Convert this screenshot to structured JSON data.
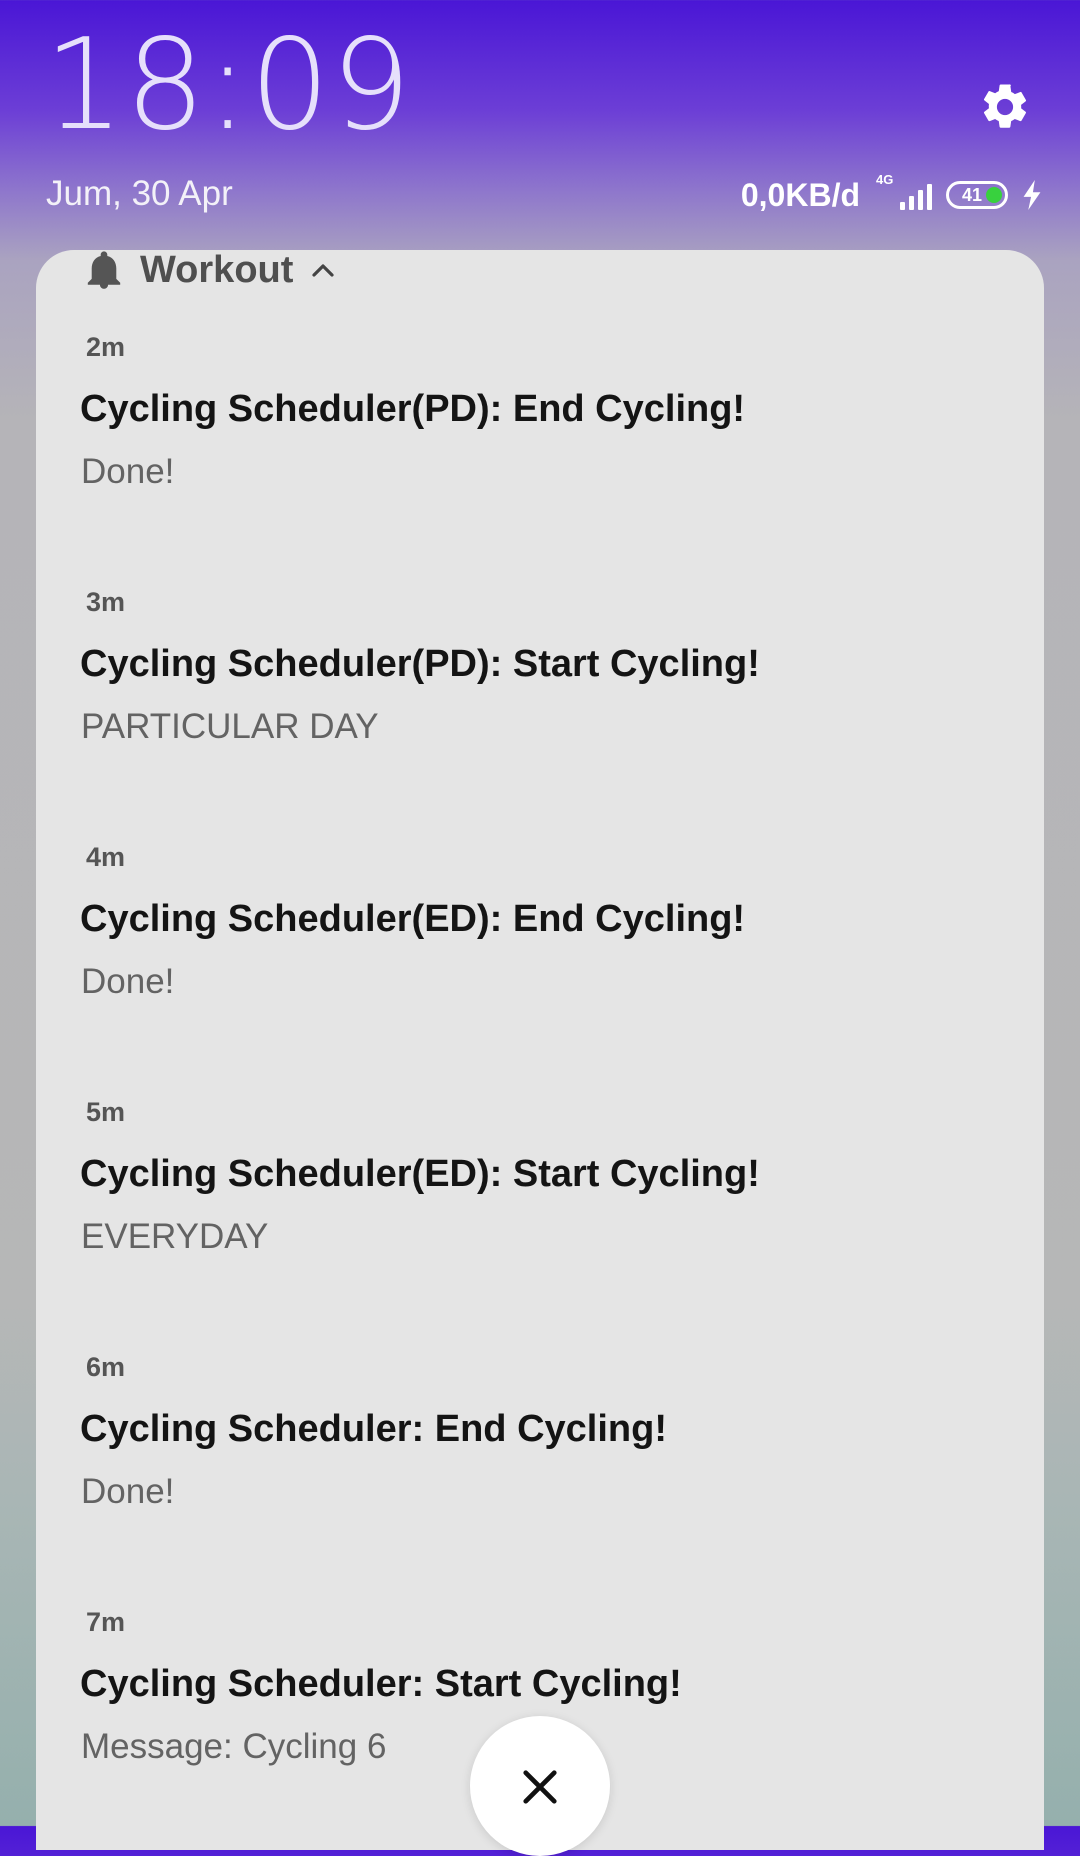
{
  "status": {
    "clock": "18:09",
    "date": "Jum, 30 Apr",
    "net_speed": "0,0KB/d",
    "network_type": "4G",
    "battery_level": "41",
    "icons": {
      "settings": "gear-icon",
      "signal": "signal-icon",
      "battery": "battery-icon",
      "charging": "lightning-icon"
    },
    "colors": {
      "gradient_top": "#4a16d6",
      "battery_fill": "#38d13e"
    }
  },
  "notification_group": {
    "app_name": "Workout",
    "icons": {
      "app": "bell-icon",
      "expand": "chevron-up-icon"
    },
    "items": [
      {
        "time": "2m",
        "title": "Cycling Scheduler(PD): End Cycling!",
        "body": "Done!"
      },
      {
        "time": "3m",
        "title": "Cycling Scheduler(PD): Start Cycling!",
        "body": "PARTICULAR DAY"
      },
      {
        "time": "4m",
        "title": "Cycling Scheduler(ED): End Cycling!",
        "body": "Done!"
      },
      {
        "time": "5m",
        "title": "Cycling Scheduler(ED): Start Cycling!",
        "body": "EVERYDAY"
      },
      {
        "time": "6m",
        "title": "Cycling Scheduler: End Cycling!",
        "body": "Done!"
      },
      {
        "time": "7m",
        "title": "Cycling Scheduler: Start Cycling!",
        "body": "Message: Cycling 6"
      }
    ]
  },
  "dismiss": {
    "icon": "close-icon"
  }
}
